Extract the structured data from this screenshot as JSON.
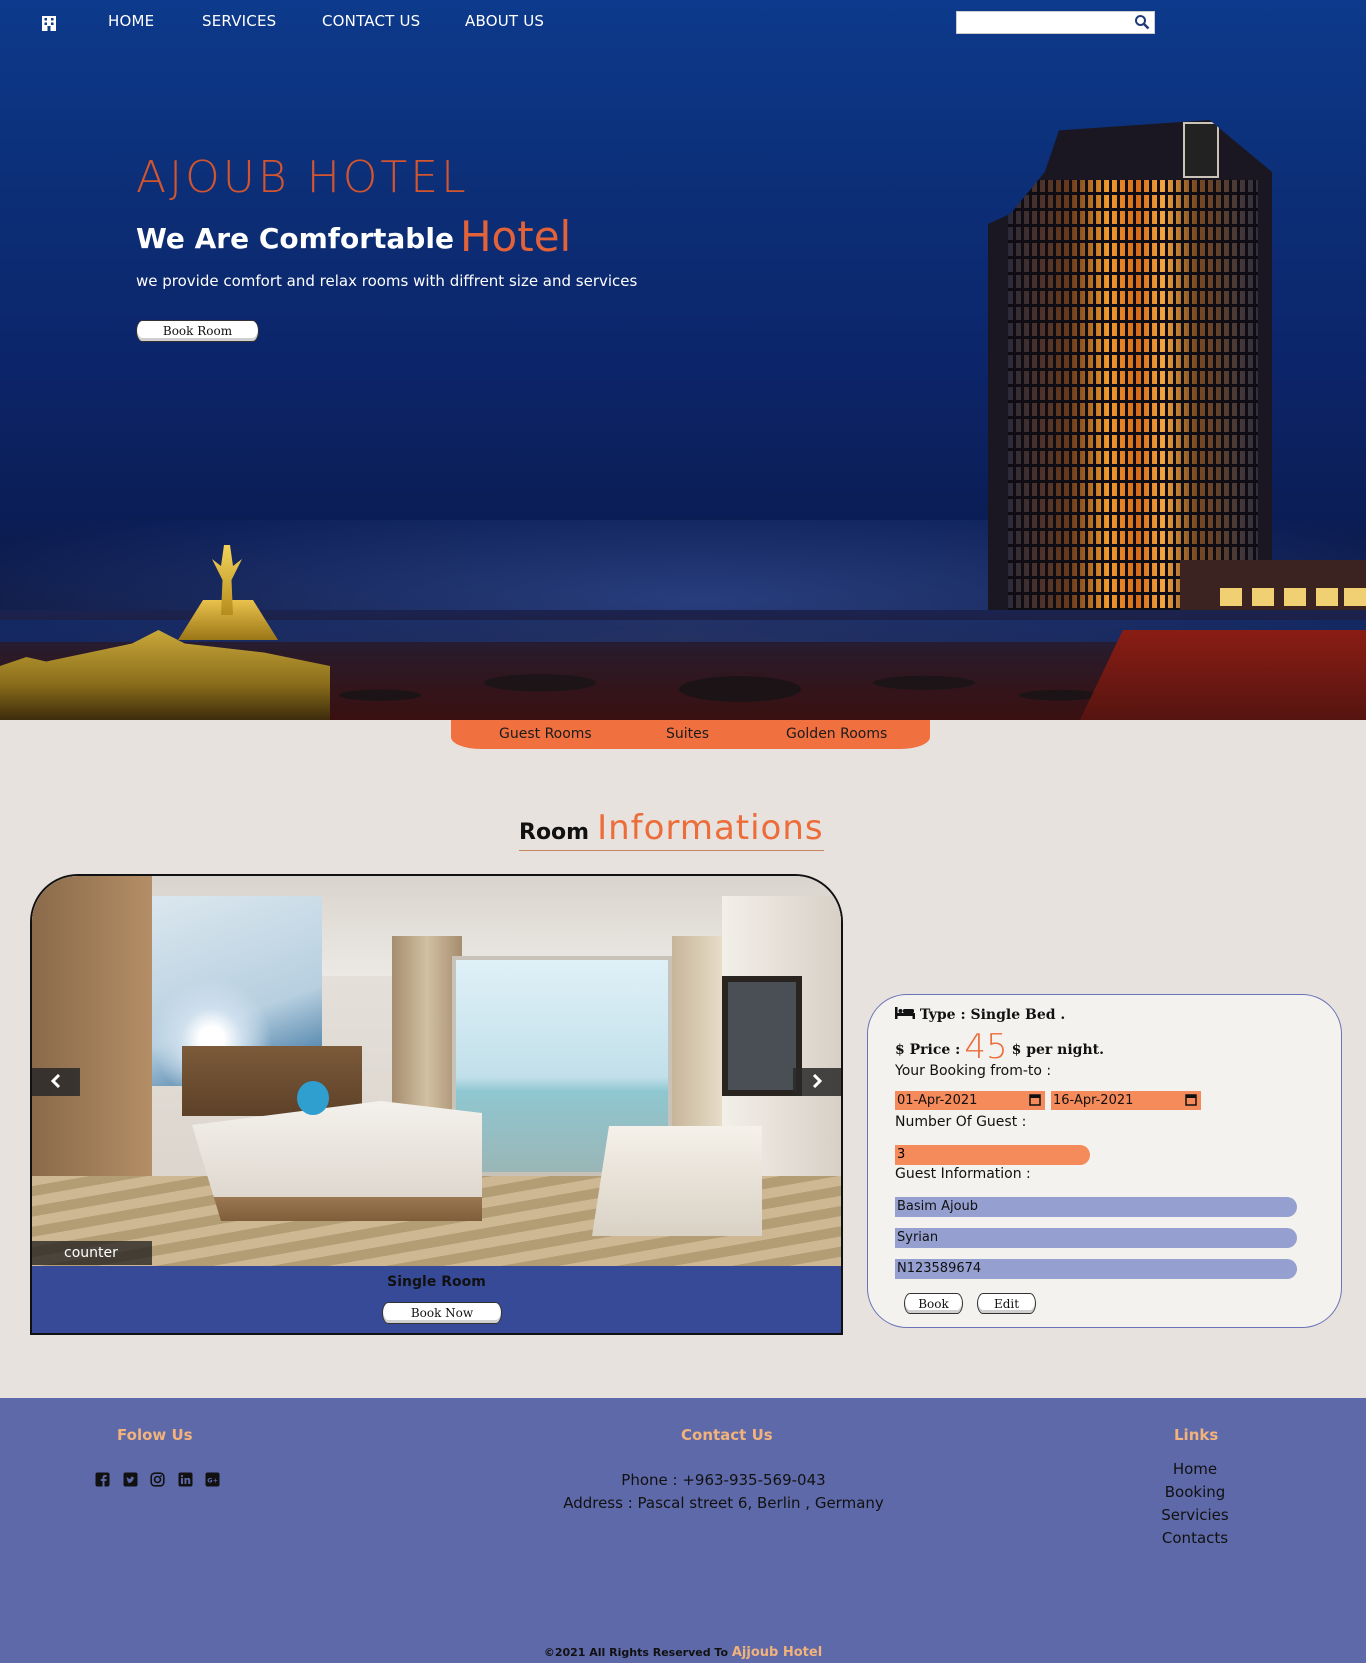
{
  "nav": {
    "links": [
      "HOME",
      "SERVICES",
      "CONTACT US",
      "ABOUT US"
    ],
    "search": {
      "value": "",
      "placeholder": ""
    }
  },
  "hero": {
    "title": "AJOUB HOTEL",
    "subtitle_lead": "We Are Comfortable",
    "subtitle_accent": "Hotel",
    "description": "we provide comfort and relax rooms with diffrent size and services",
    "button": "Book Room"
  },
  "room_tabs": [
    "Guest Rooms",
    "Suites",
    "Golden Rooms"
  ],
  "section": {
    "title_lead": "Room",
    "title_accent": "Informations"
  },
  "room_card": {
    "counter": "counter",
    "room_name": "Single Room",
    "button": "Book Now"
  },
  "booking": {
    "type_label": "Type : Single Bed .",
    "price_label": "Price :",
    "price_value": "45",
    "price_suffix": "$ per night.",
    "dates_label": "Your Booking from-to :",
    "date_from": "01-Apr-2021",
    "date_to": "16-Apr-2021",
    "guests_label": "Number Of Guest :",
    "guests_value": "3",
    "guest_info_label": "Guest Information :",
    "guest_name": "Basim Ajoub",
    "guest_nationality": "Syrian",
    "guest_passport": "N123589674",
    "book_button": "Book",
    "edit_button": "Edit"
  },
  "footer": {
    "follow_heading": "Folow Us",
    "social_icons": [
      "facebook-icon",
      "twitter-icon",
      "instagram-icon",
      "linkedin-icon",
      "google-plus-icon"
    ],
    "contact_heading": "Contact Us",
    "phone": "Phone : +963-935-569-043",
    "address": "Address : Pascal street 6, Berlin , Germany",
    "links_heading": "Links",
    "links": [
      "Home",
      "Booking",
      "Servicies",
      "Contacts"
    ],
    "copyright": "©2021 All Rights Reserved To",
    "brand": "Ajjoub Hotel"
  },
  "colors": {
    "accent": "#ec6c3a",
    "nav_bg": "#0d3a8c",
    "page_bg": "#e7e2de",
    "footer_bg": "#5e69a9",
    "footer_heading": "#f2b27c",
    "room_caption_bg": "#364a98",
    "input_orange": "#f58a5a",
    "input_blue": "#95a0d0"
  }
}
